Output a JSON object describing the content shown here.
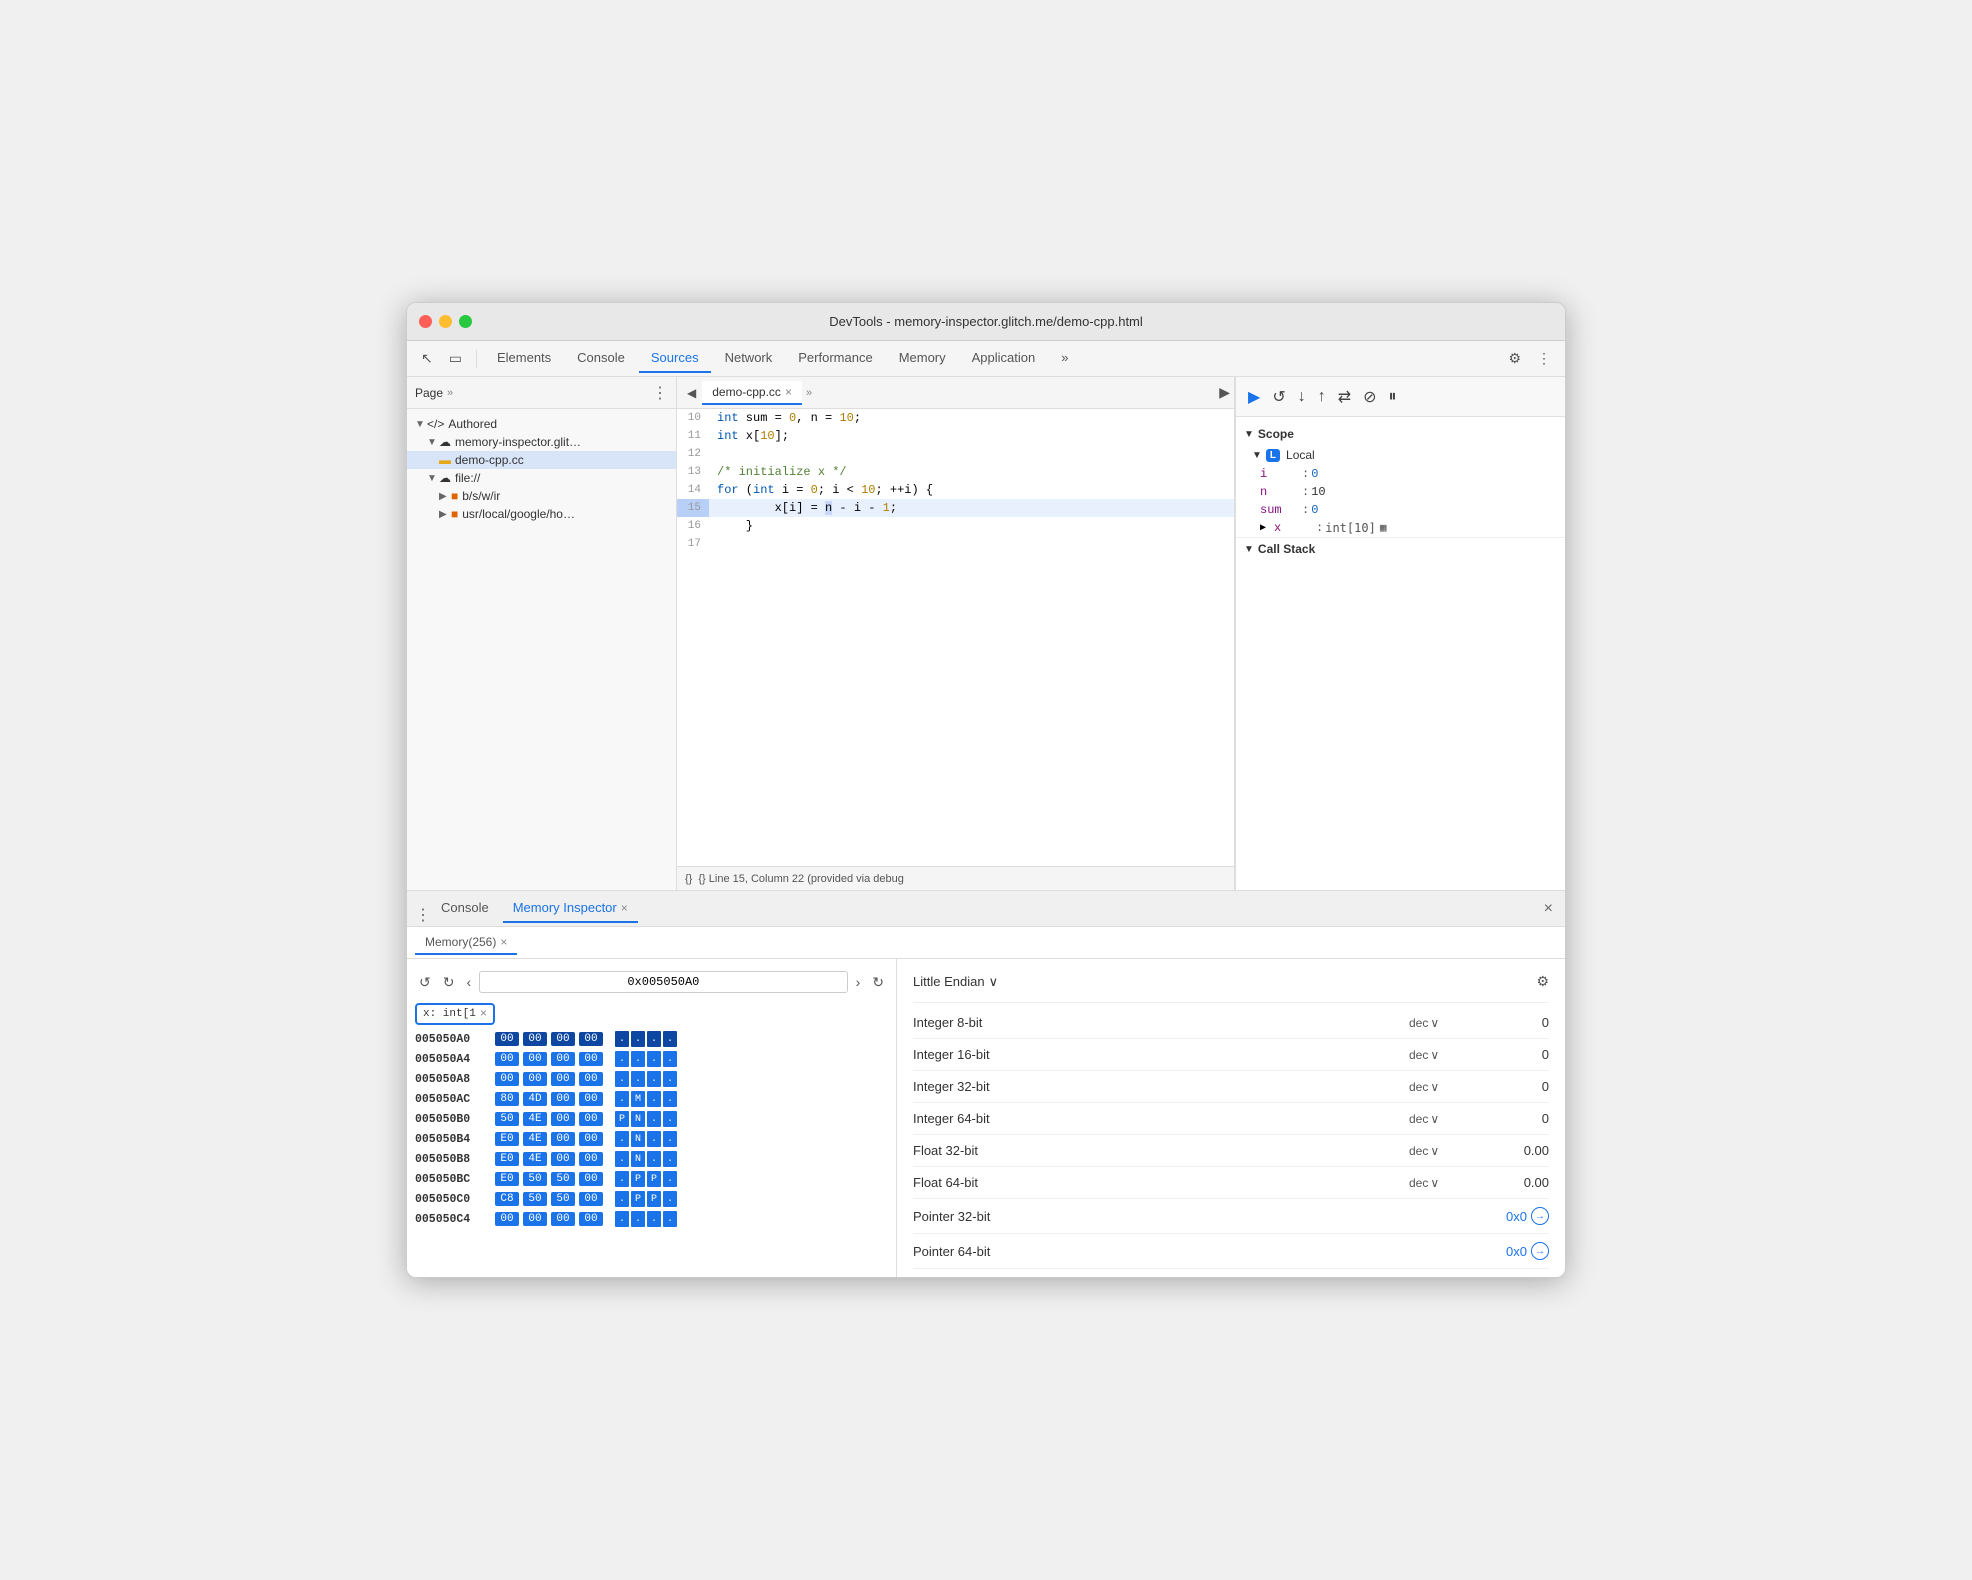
{
  "window": {
    "title": "DevTools - memory-inspector.glitch.me/demo-cpp.html"
  },
  "toolbar": {
    "tabs": [
      "Elements",
      "Console",
      "Sources",
      "Network",
      "Performance",
      "Memory",
      "Application"
    ],
    "active_tab": "Sources",
    "more_label": "»",
    "settings_label": "⚙",
    "more_menu_label": "⋮"
  },
  "left_panel": {
    "header": "Page",
    "more": "»",
    "tree": [
      {
        "label": "</> Authored",
        "indent": 0,
        "expanded": true,
        "type": "folder"
      },
      {
        "label": "memory-inspector.glit…",
        "indent": 1,
        "expanded": true,
        "type": "cloud"
      },
      {
        "label": "demo-cpp.cc",
        "indent": 2,
        "type": "file",
        "selected": true
      },
      {
        "label": "file://",
        "indent": 1,
        "expanded": true,
        "type": "cloud"
      },
      {
        "label": "b/s/w/ir",
        "indent": 2,
        "type": "folder-closed"
      },
      {
        "label": "usr/local/google/ho…",
        "indent": 2,
        "type": "folder-closed"
      }
    ]
  },
  "code_panel": {
    "tab": "demo-cpp.cc",
    "lines": [
      {
        "num": "10",
        "code": "    int sum = 0, n = 10;",
        "highlighted": false
      },
      {
        "num": "11",
        "code": "    int x[10];",
        "highlighted": false
      },
      {
        "num": "12",
        "code": "",
        "highlighted": false
      },
      {
        "num": "13",
        "code": "    /* initialize x */",
        "highlighted": false
      },
      {
        "num": "14",
        "code": "    for (int i = 0; i < 10; ++i) {",
        "highlighted": false
      },
      {
        "num": "15",
        "code": "        x[i] = n - i - 1;",
        "highlighted": true
      },
      {
        "num": "16",
        "code": "    }",
        "highlighted": false
      },
      {
        "num": "17",
        "code": "",
        "highlighted": false
      }
    ],
    "status_bar": "{}  Line 15, Column 22 (provided via debug"
  },
  "scope_panel": {
    "scope_label": "Scope",
    "local_label": "Local",
    "vars": [
      {
        "name": "i",
        "value": "0"
      },
      {
        "name": "n",
        "value": "10"
      },
      {
        "name": "sum",
        "value": "0"
      }
    ],
    "array_var": "x: int[10]",
    "call_stack_label": "Call Stack"
  },
  "debug_toolbar": {
    "buttons": [
      "resume",
      "step-over",
      "step-into",
      "step-out",
      "step-back",
      "deactivate",
      "pause"
    ]
  },
  "bottom_tabs": {
    "console_label": "Console",
    "memory_inspector_label": "Memory Inspector",
    "active": "Memory Inspector",
    "close_label": "×",
    "more_label": "⋮"
  },
  "memory_subtab": {
    "label": "Memory(256)",
    "close": "×"
  },
  "memory_nav": {
    "back": "↺",
    "forward": "↻",
    "prev": "‹",
    "next": "›",
    "address": "0x005050A0",
    "refresh": "↻"
  },
  "var_chip": {
    "label": "x: int[1",
    "close": "×"
  },
  "hex_data": [
    {
      "addr": "005050A0",
      "bold": true,
      "bytes": [
        "00",
        "00",
        "00",
        "00"
      ],
      "chars": [
        ".",
        ".",
        ".",
        "."
      ]
    },
    {
      "addr": "005050A4",
      "bold": false,
      "bytes": [
        "00",
        "00",
        "00",
        "00"
      ],
      "chars": [
        ".",
        ".",
        ".",
        "."
      ]
    },
    {
      "addr": "005050A8",
      "bold": false,
      "bytes": [
        "00",
        "00",
        "00",
        "00"
      ],
      "chars": [
        ".",
        ".",
        ".",
        "."
      ]
    },
    {
      "addr": "005050AC",
      "bold": false,
      "bytes": [
        "80",
        "4D",
        "00",
        "00"
      ],
      "chars": [
        ".",
        "M",
        ".",
        "."
      ]
    },
    {
      "addr": "005050B0",
      "bold": false,
      "bytes": [
        "50",
        "4E",
        "00",
        "00"
      ],
      "chars": [
        "P",
        "N",
        ".",
        "."
      ]
    },
    {
      "addr": "005050B4",
      "bold": false,
      "bytes": [
        "E0",
        "4E",
        "00",
        "00"
      ],
      "chars": [
        ".",
        "N",
        ".",
        "."
      ]
    },
    {
      "addr": "005050B8",
      "bold": false,
      "bytes": [
        "E0",
        "4E",
        "00",
        "00"
      ],
      "chars": [
        ".",
        "N",
        ".",
        "."
      ]
    },
    {
      "addr": "005050BC",
      "bold": false,
      "bytes": [
        "E0",
        "50",
        "50",
        "00"
      ],
      "chars": [
        ".",
        "P",
        "P",
        "."
      ]
    },
    {
      "addr": "005050C0",
      "bold": false,
      "bytes": [
        "C8",
        "50",
        "50",
        "00"
      ],
      "chars": [
        ".",
        "P",
        "P",
        "."
      ]
    },
    {
      "addr": "005050C4",
      "bold": false,
      "bytes": [
        "00",
        "00",
        "00",
        "00"
      ],
      "chars": [
        ".",
        ".",
        ".",
        "."
      ]
    }
  ],
  "data_inspector": {
    "endian_label": "Little Endian",
    "rows": [
      {
        "label": "Integer 8-bit",
        "format": "dec",
        "value": "0"
      },
      {
        "label": "Integer 16-bit",
        "format": "dec",
        "value": "0"
      },
      {
        "label": "Integer 32-bit",
        "format": "dec",
        "value": "0"
      },
      {
        "label": "Integer 64-bit",
        "format": "dec",
        "value": "0"
      },
      {
        "label": "Float 32-bit",
        "format": "dec",
        "value": "0.00"
      },
      {
        "label": "Float 64-bit",
        "format": "dec",
        "value": "0.00"
      },
      {
        "label": "Pointer 32-bit",
        "format": null,
        "value": "0x0"
      },
      {
        "label": "Pointer 64-bit",
        "format": null,
        "value": "0x0"
      }
    ]
  }
}
